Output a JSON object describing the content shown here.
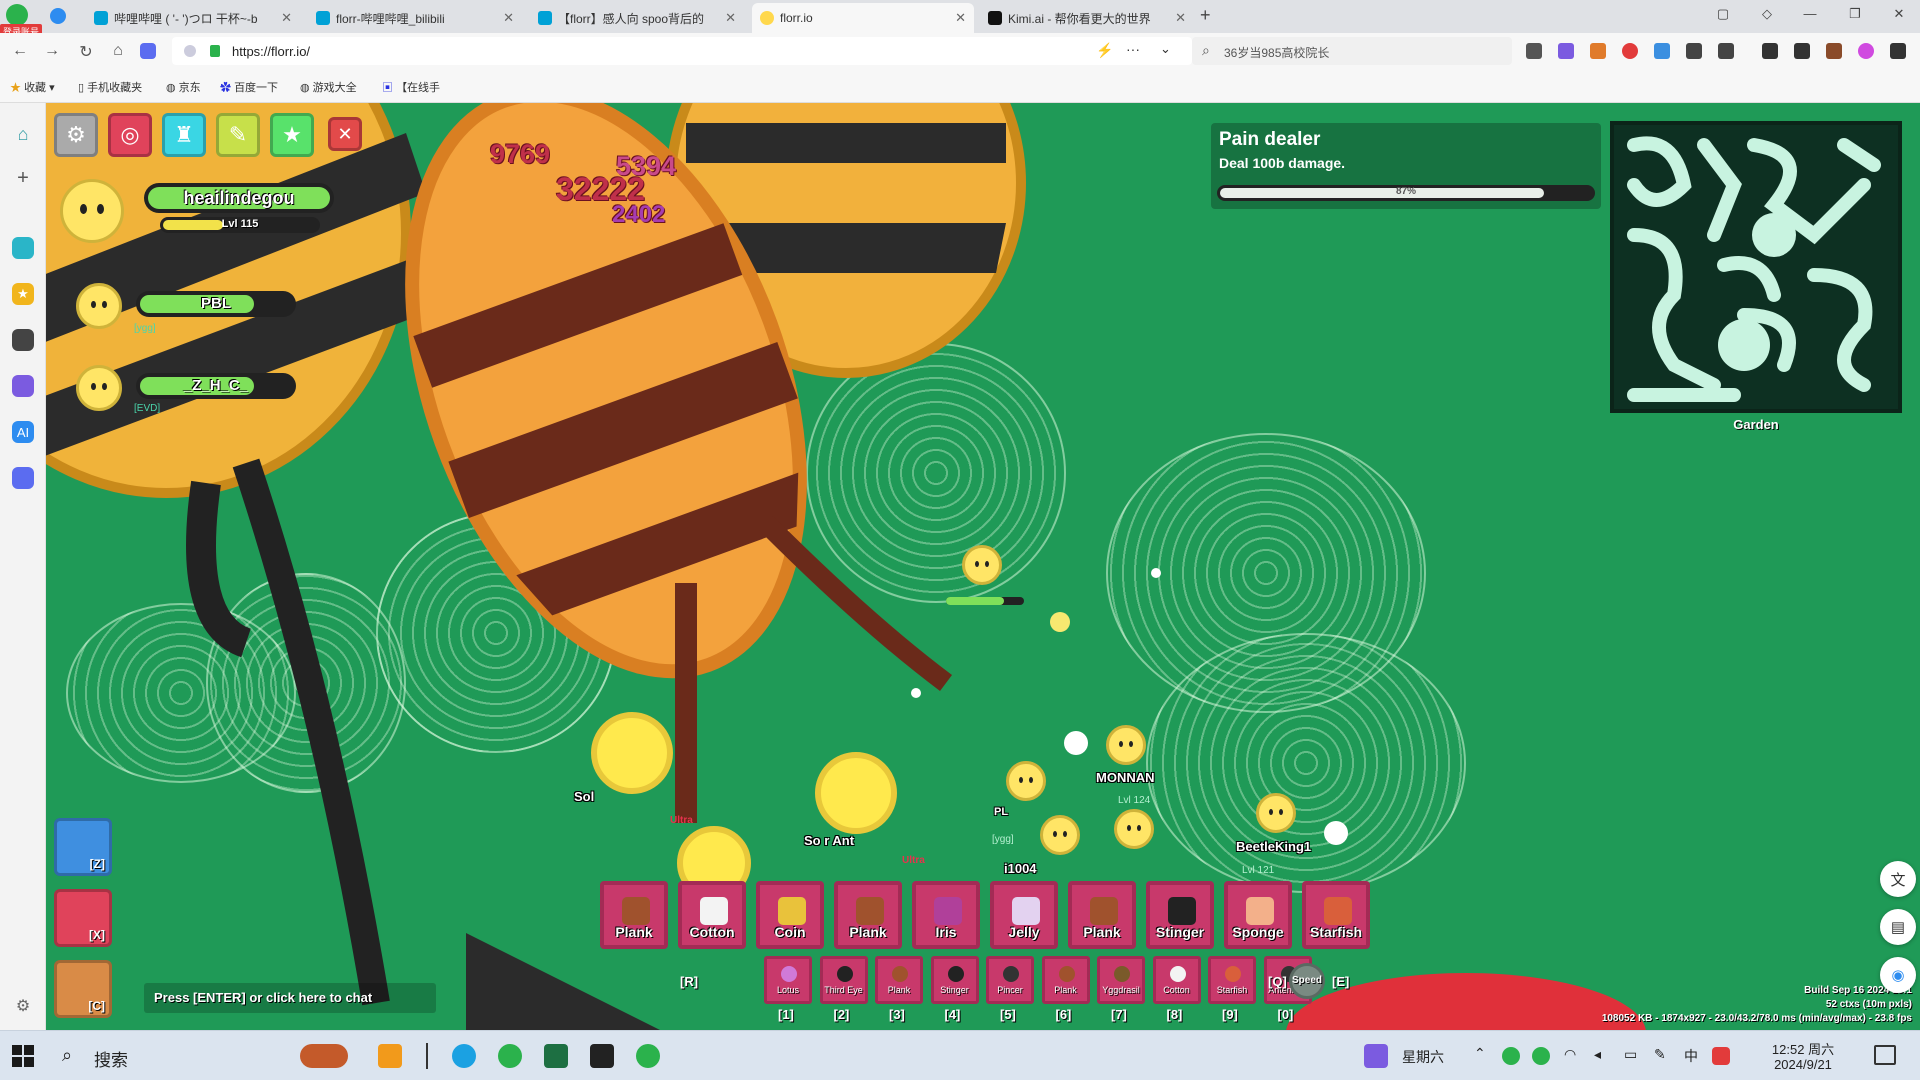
{
  "browser": {
    "badge": "登录账号",
    "tabs": [
      {
        "title": "哔哩哔哩 ( '- ')つロ 干杯~-b",
        "icon_color": "#00a1d6"
      },
      {
        "title": "florr-哔哩哔哩_bilibili",
        "icon_color": "#00a1d6"
      },
      {
        "title": "【florr】感人向 spoo背后的",
        "icon_color": "#00a1d6"
      },
      {
        "title": "florr.io",
        "icon_color": "#ffd84d"
      },
      {
        "title": "Kimi.ai - 帮你看更大的世界",
        "icon_color": "#111111"
      }
    ],
    "new_tab": "+",
    "url": "https://florr.io/",
    "search_text": "36岁当985高校院长",
    "bookmarks": [
      "收藏",
      "手机收藏夹",
      "京东",
      "百度一下",
      "游戏大全",
      "【在线手"
    ]
  },
  "game": {
    "top_buttons": [
      {
        "name": "settings",
        "color": "#aaaaaa",
        "icon": "gear-icon"
      },
      {
        "name": "mob-gallery",
        "color": "#e0435b",
        "icon": "target-icon"
      },
      {
        "name": "inventory",
        "color": "#3ad6e4",
        "icon": "castle-icon"
      },
      {
        "name": "craft",
        "color": "#c7e04a",
        "icon": "pencil-icon"
      },
      {
        "name": "achievements",
        "color": "#58e26b",
        "icon": "star-icon"
      },
      {
        "name": "close",
        "color": "#e24a4a",
        "icon": "close-icon"
      }
    ],
    "player": {
      "name": "heailindegou",
      "level": "Lvl 115"
    },
    "squad": [
      {
        "name": "PBL",
        "tag": "[ygg]"
      },
      {
        "name": "_Z_H_C_",
        "tag": "[EVD]"
      }
    ],
    "damage_numbers": [
      "9769",
      "5394",
      "32222",
      "2402"
    ],
    "quest": {
      "title": "Pain dealer",
      "desc": "Deal 100b damage.",
      "progress_text": "87%",
      "progress": 0.87
    },
    "minimap_label": "Garden",
    "names": {
      "monnan": "MONNAN",
      "monnan_lvl": "Lvl 124",
      "i1004": "i1004",
      "beetleking": "BeetleKing1",
      "beetleking_lvl": "Lvl 121",
      "sol": "Sol",
      "soldier_ant": "So    r Ant",
      "ultra": "Ultra",
      "pl": "PL",
      "ygg": "[ygg]"
    },
    "main_slots": [
      {
        "label": "Plank",
        "color": "#a0522d"
      },
      {
        "label": "Cotton",
        "color": "#f3f3f3"
      },
      {
        "label": "Coin",
        "color": "#e9c23b"
      },
      {
        "label": "Plank",
        "color": "#a0522d"
      },
      {
        "label": "Iris",
        "color": "#b0409a"
      },
      {
        "label": "Jelly",
        "color": "#e3d2f0"
      },
      {
        "label": "Plank",
        "color": "#a0522d"
      },
      {
        "label": "Stinger",
        "color": "#222222"
      },
      {
        "label": "Sponge",
        "color": "#f3b08a"
      },
      {
        "label": "Starfish",
        "color": "#d95f3b"
      }
    ],
    "secondary_slots": [
      {
        "label": "Lotus",
        "key": "[1]",
        "color": "#d07ad8"
      },
      {
        "label": "Third Eye",
        "key": "[2]",
        "color": "#222222"
      },
      {
        "label": "Plank",
        "key": "[3]",
        "color": "#a0522d"
      },
      {
        "label": "Stinger",
        "key": "[4]",
        "color": "#222222"
      },
      {
        "label": "Pincer",
        "key": "[5]",
        "color": "#333333"
      },
      {
        "label": "Plank",
        "key": "[6]",
        "color": "#a0522d"
      },
      {
        "label": "Yggdrasil",
        "key": "[7]",
        "color": "#7a5a2a"
      },
      {
        "label": "Cotton",
        "key": "[8]",
        "color": "#f3f3f3"
      },
      {
        "label": "Starfish",
        "key": "[9]",
        "color": "#d95f3b"
      },
      {
        "label": "Antennae",
        "key": "[0]",
        "color": "#333333"
      }
    ],
    "swap_key": "[R]",
    "speed": {
      "label": "Speed",
      "left_key": "[Q]",
      "right_key": "[E]"
    },
    "abilities": [
      {
        "key": "[Z]",
        "color": "#3f8fe0"
      },
      {
        "key": "[X]",
        "color": "#e0435b"
      },
      {
        "key": "[C]",
        "color": "#d98b47"
      }
    ],
    "chat_prompt": "Press [ENTER] or click here to chat",
    "debug": {
      "build": "Build Sep 16 2024 18:1",
      "ctxs": "52 ctxs (10m pxls)",
      "perf": "108052 KB - 1874x927 - 23.0/43.2/78.0 ms (min/avg/max) - 23.8 fps"
    }
  },
  "taskbar": {
    "search": "搜索",
    "weekday": "星期六",
    "time": "12:52 周六",
    "date": "2024/9/21"
  }
}
